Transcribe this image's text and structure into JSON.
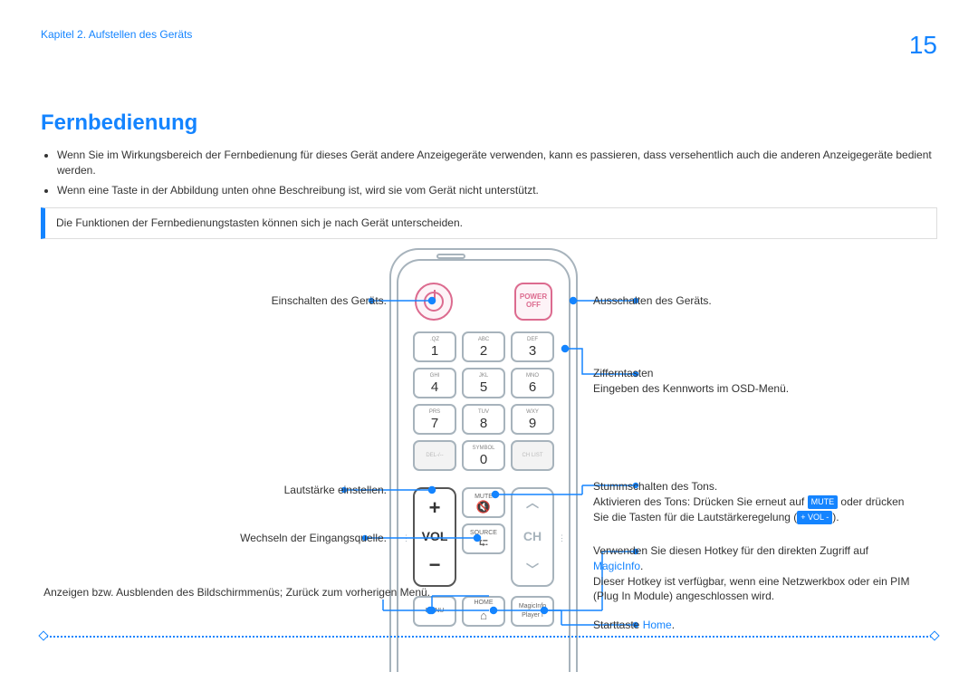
{
  "header": {
    "chapter": "Kapitel 2. Aufstellen des Geräts",
    "page": "15"
  },
  "title": "Fernbedienung",
  "bullets": [
    "Wenn Sie im Wirkungsbereich der Fernbedienung für dieses Gerät andere Anzeigegeräte verwenden, kann es passieren, dass versehentlich auch die anderen Anzeigegeräte bedient werden.",
    "Wenn eine Taste in der Abbildung unten ohne Beschreibung ist, wird sie vom Gerät nicht unterstützt."
  ],
  "note": "Die Funktionen der Fernbedienungstasten können sich je nach Gerät unterscheiden.",
  "remote": {
    "power_off_top": "POWER",
    "power_off_bottom": "OFF",
    "keys": [
      {
        "t": ".QZ",
        "n": "1"
      },
      {
        "t": "ABC",
        "n": "2"
      },
      {
        "t": "DEF",
        "n": "3"
      },
      {
        "t": "GHI",
        "n": "4"
      },
      {
        "t": "JKL",
        "n": "5"
      },
      {
        "t": "MNO",
        "n": "6"
      },
      {
        "t": "PRS",
        "n": "7"
      },
      {
        "t": "TUV",
        "n": "8"
      },
      {
        "t": "WXY",
        "n": "9"
      },
      {
        "t": "DEL-/--",
        "n": "",
        "ghost": true
      },
      {
        "t": "SYMBOL",
        "n": "0"
      },
      {
        "t": "CH LIST",
        "n": "",
        "ghost": true
      }
    ],
    "vol": {
      "plus": "+",
      "label": "VOL",
      "minus": "−"
    },
    "ch": {
      "up": "︿",
      "label": "CH",
      "down": "﹀"
    },
    "mute": "MUTE",
    "source": "SOURCE",
    "menu": "MENU",
    "home": "HOME",
    "magicinfo_top": "MagicInfo",
    "magicinfo_bottom": "Player I"
  },
  "callouts": {
    "power_on": "Einschalten des Geräts.",
    "power_off": "Ausschalten des Geräts.",
    "digits_t": "Zifferntasten",
    "digits_b": "Eingeben des Kennworts im OSD-Menü.",
    "volume": "Lautstärke einstellen.",
    "source": "Wechseln der Eingangsquelle.",
    "menu": "Anzeigen bzw. Ausblenden des Bildschirmmenüs; Zurück zum vorherigen Menü.",
    "mute_1": "Stummschalten des Tons.",
    "mute_2a": "Aktivieren des Tons: Drücken Sie erneut auf ",
    "mute_2_badge": "MUTE",
    "mute_2b": " oder drücken Sie die Tasten für die Lautstärkeregelung (",
    "mute_2_badge2": "+ VOL -",
    "mute_2c": ").",
    "magic_a": "Verwenden Sie diesen Hotkey für den direkten Zugriff auf ",
    "magic_link": "MagicInfo",
    "magic_b": ".",
    "magic_c": "Dieser Hotkey ist verfügbar, wenn eine Netzwerkbox oder ein PIM (Plug In Module) angeschlossen wird.",
    "home_a": "Starttaste ",
    "home_link": "Home",
    "home_b": "."
  }
}
